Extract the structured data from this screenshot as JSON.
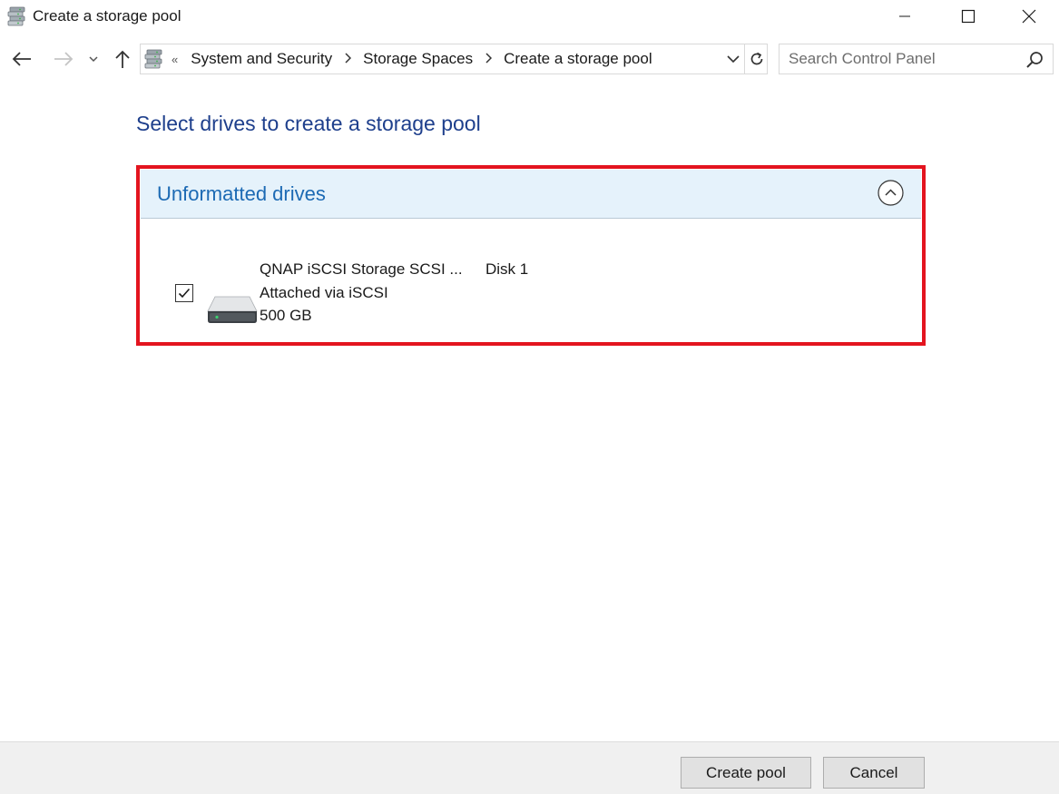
{
  "window": {
    "title": "Create a storage pool",
    "icon": "storage-spaces-icon",
    "controls": {
      "minimize": "minimize-icon",
      "maximize": "maximize-icon",
      "close": "close-icon"
    }
  },
  "nav": {
    "back_icon": "arrow-left-icon",
    "forward_icon": "arrow-right-icon",
    "recent_icon": "chevron-down-icon",
    "up_icon": "arrow-up-icon"
  },
  "address": {
    "overflow": "«",
    "separator": ">",
    "crumbs": [
      "System and Security",
      "Storage Spaces",
      "Create a storage pool"
    ]
  },
  "search": {
    "placeholder": "Search Control Panel",
    "value": ""
  },
  "main": {
    "heading": "Select drives to create a storage pool",
    "group": {
      "title": "Unformatted drives",
      "expanded": true,
      "drives": [
        {
          "checked": true,
          "name": "QNAP iSCSI Storage SCSI ...",
          "disk": "Disk 1",
          "connection": "Attached via iSCSI",
          "size": "500 GB"
        }
      ]
    }
  },
  "footer": {
    "create_label": "Create pool",
    "cancel_label": "Cancel"
  },
  "colors": {
    "heading": "#1e3f8c",
    "group_title": "#1c6ab4",
    "group_header_bg": "#e5f2fb",
    "highlight_border": "#e3141f",
    "footer_bg": "#f0f0f0"
  }
}
